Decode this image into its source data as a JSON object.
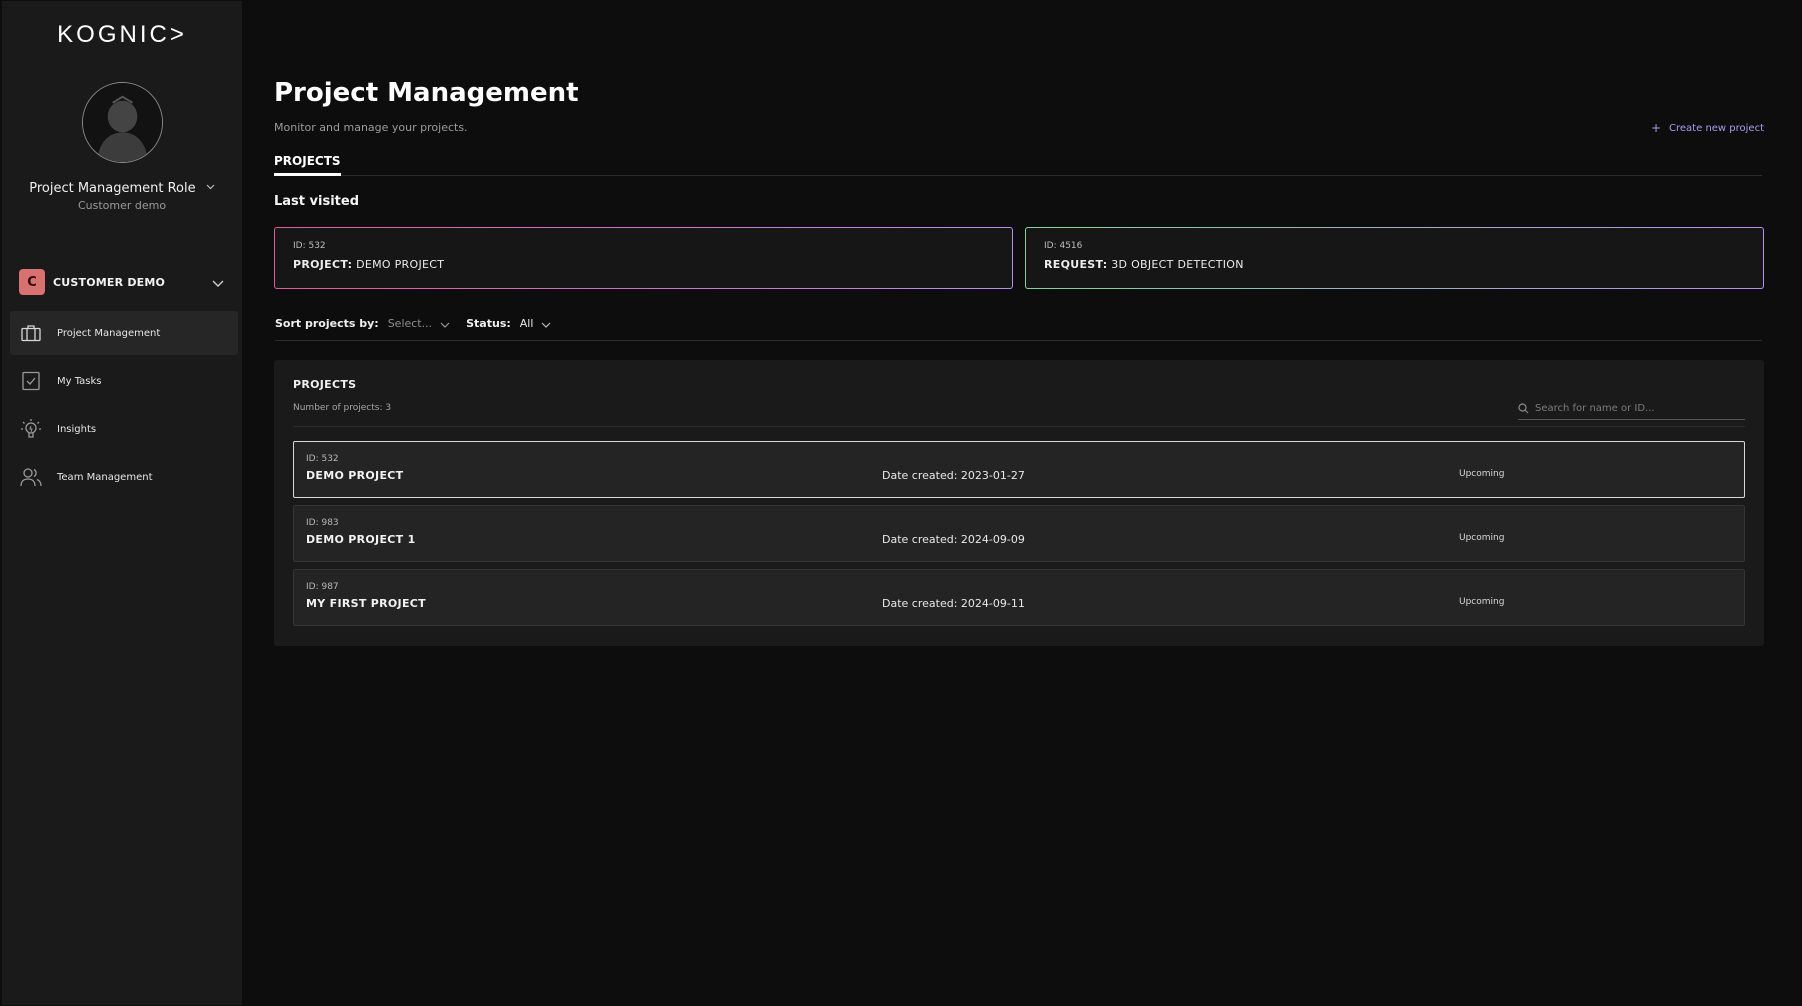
{
  "app": {
    "logo_text": "KOGNIC>"
  },
  "user": {
    "role": "Project Management Role",
    "organization": "Customer demo"
  },
  "workspace": {
    "badge": "C",
    "name": "CUSTOMER DEMO"
  },
  "sidebar": {
    "items": [
      {
        "label": "Project Management",
        "icon": "briefcase-icon",
        "active": true
      },
      {
        "label": "My Tasks",
        "icon": "task-check-icon",
        "active": false
      },
      {
        "label": "Insights",
        "icon": "lightbulb-icon",
        "active": false
      },
      {
        "label": "Team Management",
        "icon": "team-icon",
        "active": false
      }
    ]
  },
  "page": {
    "title": "Project Management",
    "subtitle": "Monitor and manage your projects.",
    "create_label": "Create new project",
    "tab_label": "PROJECTS",
    "last_visited_label": "Last visited"
  },
  "last_visited": [
    {
      "id_label": "ID: 532",
      "kind": "PROJECT:",
      "name": "DEMO PROJECT",
      "accent": "#e05a9b"
    },
    {
      "id_label": "ID: 4516",
      "kind": "REQUEST:",
      "name": "3D OBJECT DETECTION",
      "accent": "#7fd49a"
    }
  ],
  "filters": {
    "sort_label": "Sort projects by:",
    "sort_value": "Select...",
    "status_label": "Status:",
    "status_value": "All"
  },
  "projects_panel": {
    "title": "PROJECTS",
    "count_label": "Number of projects: 3",
    "search_placeholder": "Search for name or ID..."
  },
  "projects": [
    {
      "id_label": "ID: 532",
      "name": "DEMO PROJECT",
      "date": "Date created: 2023-01-27",
      "status": "Upcoming"
    },
    {
      "id_label": "ID: 983",
      "name": "DEMO PROJECT 1",
      "date": "Date created: 2024-09-09",
      "status": "Upcoming"
    },
    {
      "id_label": "ID: 987",
      "name": "MY FIRST PROJECT",
      "date": "Date created: 2024-09-11",
      "status": "Upcoming"
    }
  ],
  "colors": {
    "accent": "#a99cf0",
    "workspace_badge": "#d8716f"
  }
}
